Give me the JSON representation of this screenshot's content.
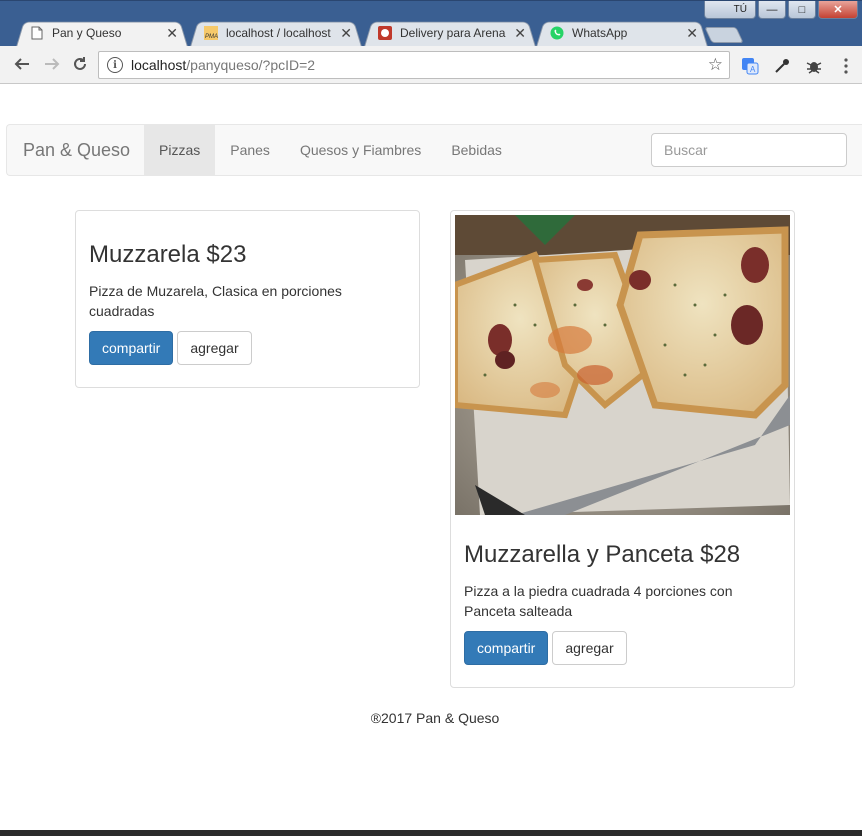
{
  "window": {
    "user_label": "TÚ"
  },
  "tabs": [
    {
      "title": "Pan y Queso",
      "icon": "page-icon",
      "active": true
    },
    {
      "title": "localhost / localhost",
      "icon": "phpmyadmin-icon",
      "active": false
    },
    {
      "title": "Delivery para Arenale",
      "icon": "delivery-icon",
      "active": false
    },
    {
      "title": "WhatsApp",
      "icon": "whatsapp-icon",
      "active": false
    }
  ],
  "address": {
    "host": "localhost",
    "path": "/panyqueso/?pcID=2"
  },
  "navbar": {
    "brand": "Pan & Queso",
    "links": [
      "Pizzas",
      "Panes",
      "Quesos y Fiambres",
      "Bebidas"
    ],
    "active_link": "Pizzas",
    "search_placeholder": "Buscar"
  },
  "products": [
    {
      "title": "Muzzarela $23",
      "description": "Pizza de Muzarela, Clasica en porciones cuadradas",
      "share_label": "compartir",
      "add_label": "agregar",
      "has_image": false
    },
    {
      "title": "Muzzarella y Panceta $28",
      "description": "Pizza a la piedra cuadrada 4 porciones con Panceta salteada",
      "share_label": "compartir",
      "add_label": "agregar",
      "has_image": true
    }
  ],
  "footer": {
    "text": "®2017 Pan & Queso"
  },
  "colors": {
    "primary": "#337ab7",
    "navbar_bg": "#f8f8f8",
    "active_tab": "#e7e7e7",
    "chrome": "#3a5f92"
  }
}
